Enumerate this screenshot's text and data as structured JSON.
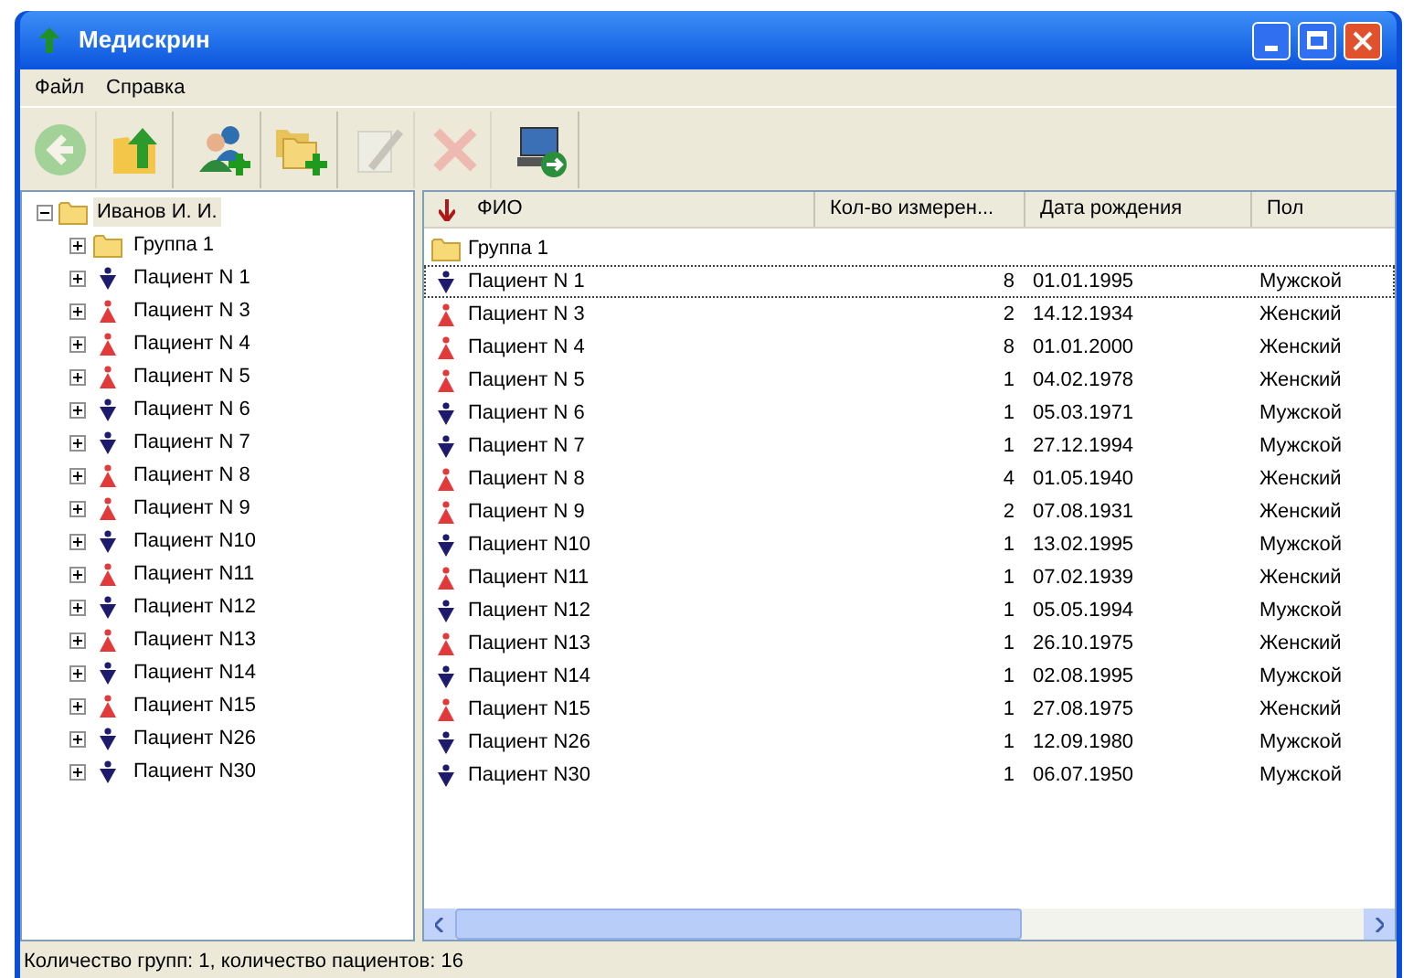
{
  "window": {
    "title": "Медискрин"
  },
  "menu": [
    "Файл",
    "Справка"
  ],
  "toolbar": [
    {
      "kind": "back",
      "disabled": true
    },
    {
      "kind": "up",
      "disabled": false
    },
    {
      "kind": "add-patient",
      "disabled": false
    },
    {
      "kind": "add-group",
      "disabled": false
    },
    {
      "kind": "edit",
      "disabled": true
    },
    {
      "kind": "delete",
      "disabled": true
    },
    {
      "kind": "export",
      "disabled": false
    }
  ],
  "tree": {
    "label": "Иванов И. И.",
    "kind": "folder",
    "expanded": true,
    "selected": true,
    "children": [
      {
        "label": "Группа 1",
        "kind": "folder",
        "expanded": false,
        "selected": false
      },
      {
        "label": "Пациент N 1",
        "kind": "male",
        "expanded": false,
        "selected": false
      },
      {
        "label": "Пациент N 3",
        "kind": "female",
        "expanded": false,
        "selected": false
      },
      {
        "label": "Пациент N 4",
        "kind": "female",
        "expanded": false,
        "selected": false
      },
      {
        "label": "Пациент N 5",
        "kind": "female",
        "expanded": false,
        "selected": false
      },
      {
        "label": "Пациент N 6",
        "kind": "male",
        "expanded": false,
        "selected": false
      },
      {
        "label": "Пациент N 7",
        "kind": "male",
        "expanded": false,
        "selected": false
      },
      {
        "label": "Пациент N 8",
        "kind": "female",
        "expanded": false,
        "selected": false
      },
      {
        "label": "Пациент N 9",
        "kind": "female",
        "expanded": false,
        "selected": false
      },
      {
        "label": "Пациент N10",
        "kind": "male",
        "expanded": false,
        "selected": false
      },
      {
        "label": "Пациент N11",
        "kind": "female",
        "expanded": false,
        "selected": false
      },
      {
        "label": "Пациент N12",
        "kind": "male",
        "expanded": false,
        "selected": false
      },
      {
        "label": "Пациент N13",
        "kind": "female",
        "expanded": false,
        "selected": false
      },
      {
        "label": "Пациент N14",
        "kind": "male",
        "expanded": false,
        "selected": false
      },
      {
        "label": "Пациент N15",
        "kind": "female",
        "expanded": false,
        "selected": false
      },
      {
        "label": "Пациент N26",
        "kind": "male",
        "expanded": false,
        "selected": false
      },
      {
        "label": "Пациент N30",
        "kind": "male",
        "expanded": false,
        "selected": false
      }
    ]
  },
  "table": {
    "columns": [
      "ФИО",
      "Кол-во измерен...",
      "Дата рождения",
      "Пол"
    ],
    "rows": [
      {
        "kind": "folder",
        "name": "Группа 1",
        "selected": false
      },
      {
        "kind": "male",
        "name": "Пациент N 1",
        "count": "8",
        "birth": "01.01.1995",
        "sex": "Мужской",
        "selected": true
      },
      {
        "kind": "female",
        "name": "Пациент N 3",
        "count": "2",
        "birth": "14.12.1934",
        "sex": "Женский",
        "selected": false
      },
      {
        "kind": "female",
        "name": "Пациент N 4",
        "count": "8",
        "birth": "01.01.2000",
        "sex": "Женский",
        "selected": false
      },
      {
        "kind": "female",
        "name": "Пациент N 5",
        "count": "1",
        "birth": "04.02.1978",
        "sex": "Женский",
        "selected": false
      },
      {
        "kind": "male",
        "name": "Пациент N 6",
        "count": "1",
        "birth": "05.03.1971",
        "sex": "Мужской",
        "selected": false
      },
      {
        "kind": "male",
        "name": "Пациент N 7",
        "count": "1",
        "birth": "27.12.1994",
        "sex": "Мужской",
        "selected": false
      },
      {
        "kind": "female",
        "name": "Пациент N 8",
        "count": "4",
        "birth": "01.05.1940",
        "sex": "Женский",
        "selected": false
      },
      {
        "kind": "female",
        "name": "Пациент N 9",
        "count": "2",
        "birth": "07.08.1931",
        "sex": "Женский",
        "selected": false
      },
      {
        "kind": "male",
        "name": "Пациент N10",
        "count": "1",
        "birth": "13.02.1995",
        "sex": "Мужской",
        "selected": false
      },
      {
        "kind": "female",
        "name": "Пациент N11",
        "count": "1",
        "birth": "07.02.1939",
        "sex": "Женский",
        "selected": false
      },
      {
        "kind": "male",
        "name": "Пациент N12",
        "count": "1",
        "birth": "05.05.1994",
        "sex": "Мужской",
        "selected": false
      },
      {
        "kind": "female",
        "name": "Пациент N13",
        "count": "1",
        "birth": "26.10.1975",
        "sex": "Женский",
        "selected": false
      },
      {
        "kind": "male",
        "name": "Пациент N14",
        "count": "1",
        "birth": "02.08.1995",
        "sex": "Мужской",
        "selected": false
      },
      {
        "kind": "female",
        "name": "Пациент N15",
        "count": "1",
        "birth": "27.08.1975",
        "sex": "Женский",
        "selected": false
      },
      {
        "kind": "male",
        "name": "Пациент N26",
        "count": "1",
        "birth": "12.09.1980",
        "sex": "Мужской",
        "selected": false
      },
      {
        "kind": "male",
        "name": "Пациент N30",
        "count": "1",
        "birth": "06.07.1950",
        "sex": "Мужской",
        "selected": false
      }
    ]
  },
  "status_bar": "Количество групп: 1, количество пациентов: 16"
}
